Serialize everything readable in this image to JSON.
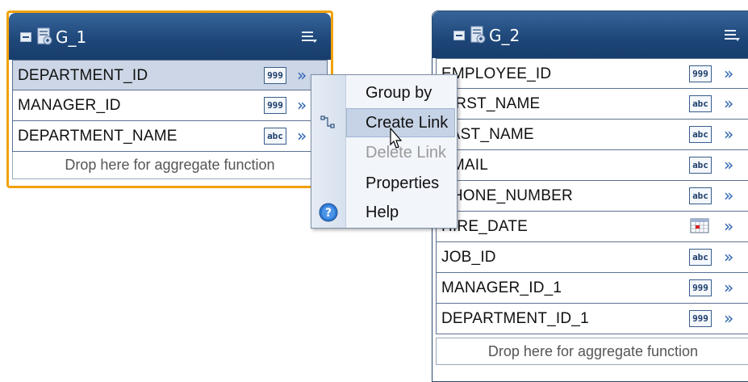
{
  "groups": [
    {
      "title": "G_1",
      "columns": [
        {
          "name": "DEPARTMENT_ID",
          "type_label": "999"
        },
        {
          "name": "MANAGER_ID",
          "type_label": "999"
        },
        {
          "name": "DEPARTMENT_NAME",
          "type_label": "abc"
        }
      ],
      "drop_text": "Drop here for aggregate function"
    },
    {
      "title": "G_2",
      "columns": [
        {
          "name": "EMPLOYEE_ID",
          "type_label": "999"
        },
        {
          "name": "FIRST_NAME",
          "type_label": "abc"
        },
        {
          "name": "LAST_NAME",
          "type_label": "abc"
        },
        {
          "name": "EMAIL",
          "type_label": "abc"
        },
        {
          "name": "PHONE_NUMBER",
          "type_label": "abc"
        },
        {
          "name": "HIRE_DATE",
          "type_label": ""
        },
        {
          "name": "JOB_ID",
          "type_label": "abc"
        },
        {
          "name": "MANAGER_ID_1",
          "type_label": "999"
        },
        {
          "name": "DEPARTMENT_ID_1",
          "type_label": "999"
        }
      ],
      "drop_text": "Drop here for aggregate function"
    }
  ],
  "context_menu": {
    "items": [
      "Group by",
      "Create Link",
      "Delete Link",
      "Properties",
      "Help"
    ]
  },
  "icons": {
    "collapse": "collapse-icon",
    "group": "data-group-icon",
    "menu": "menu-list-icon",
    "expand": "double-chevron-right-icon",
    "link": "link-icon",
    "help": "help-icon",
    "calendar": "calendar-icon",
    "cursor": "mouse-pointer-icon"
  },
  "colors": {
    "header": "#1e4678",
    "selection_border": "#f2a10a",
    "selected_row": "#ccd6e6",
    "menu_hover": "#c6d3e6"
  }
}
